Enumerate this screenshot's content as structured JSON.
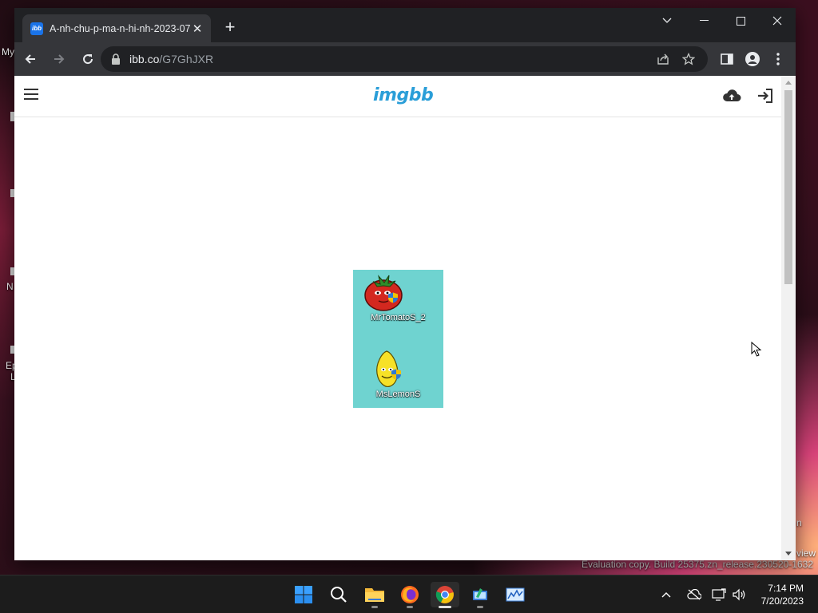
{
  "browser": {
    "tab": {
      "favicon_text": "ibb",
      "title": "A-nh-chu-p-ma-n-hi-nh-2023-07"
    },
    "address": {
      "host": "ibb.co",
      "path": "/G7GhJXR"
    }
  },
  "site": {
    "logo_text": "imgbb",
    "brand_color": "#2a9ed8"
  },
  "screenshot": {
    "items": [
      {
        "label": "MrTomatoS_2",
        "icon": "tomato-icon"
      },
      {
        "label": "MsLemonS",
        "icon": "lemon-icon"
      }
    ],
    "background_color": "#6fd3d0"
  },
  "desktop": {
    "fragments": [
      "My",
      "N",
      "Ep",
      "L",
      "n",
      "view"
    ],
    "watermark": "Evaluation copy. Build 25375.zn_release.230520-1632"
  },
  "taskbar": {
    "apps": [
      "start-icon",
      "search-icon",
      "file-explorer-icon",
      "firefox-icon",
      "chrome-icon",
      "app-icon-green",
      "app-icon-chart"
    ],
    "time": "7:14 PM",
    "date": "7/20/2023"
  }
}
